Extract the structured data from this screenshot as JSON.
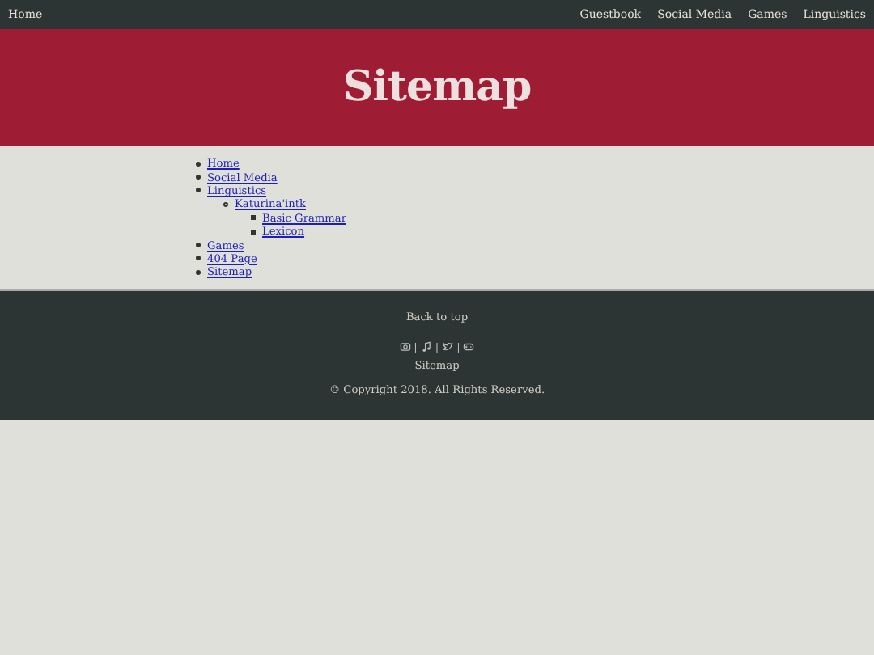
{
  "nav": {
    "home": "Home",
    "links": [
      "Guestbook",
      "Social Media",
      "Games",
      "Linguistics"
    ]
  },
  "header": {
    "title": "Sitemap"
  },
  "sitemap": [
    {
      "label": "Home"
    },
    {
      "label": "Social Media"
    },
    {
      "label": "Linguistics",
      "children": [
        {
          "label": "Katurina'intk",
          "children": [
            {
              "label": "Basic Grammar"
            },
            {
              "label": "Lexicon"
            }
          ]
        }
      ]
    },
    {
      "label": "Games"
    },
    {
      "label": "404 Page"
    },
    {
      "label": "Sitemap"
    }
  ],
  "footer": {
    "back_to_top": "Back to top",
    "separators": [
      "|",
      "|",
      "|"
    ],
    "sitemap_link": "Sitemap",
    "copyright": "© Copyright 2018. All Rights Reserved."
  }
}
